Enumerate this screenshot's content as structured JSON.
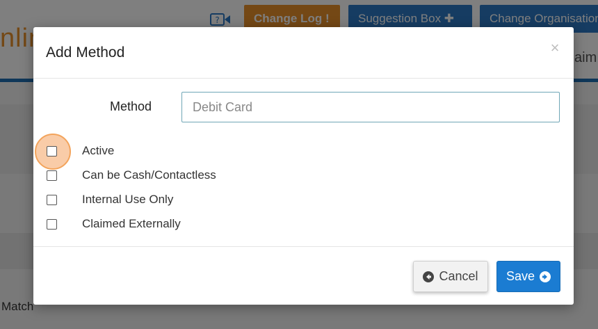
{
  "background": {
    "logo_text": "nlin",
    "buttons": {
      "change_log": "Change Log !",
      "suggestion_box": "Suggestion Box ✚",
      "change_organisation": "Change Organisation"
    },
    "tab_fragment": "aim",
    "match_label": "Match",
    "colors": {
      "brand_orange": "#e8912b",
      "brand_blue": "#2c79c4"
    }
  },
  "modal": {
    "title": "Add Method",
    "close_glyph": "×",
    "method": {
      "label": "Method",
      "placeholder": "Debit Card",
      "value": ""
    },
    "checkboxes": [
      {
        "label": "Active",
        "checked": false,
        "focused": true
      },
      {
        "label": "Can be Cash/Contactless",
        "checked": false
      },
      {
        "label": "Internal Use Only",
        "checked": false
      },
      {
        "label": "Claimed Externally",
        "checked": false
      }
    ],
    "footer": {
      "cancel_label": "Cancel",
      "cancel_icon": "arrow-circle-left-icon",
      "save_label": "Save",
      "save_icon": "arrow-circle-right-icon"
    },
    "colors": {
      "save_blue": "#1b7cd2",
      "input_border": "#6fa6b6",
      "focus_ring": "#f3a45c"
    }
  }
}
